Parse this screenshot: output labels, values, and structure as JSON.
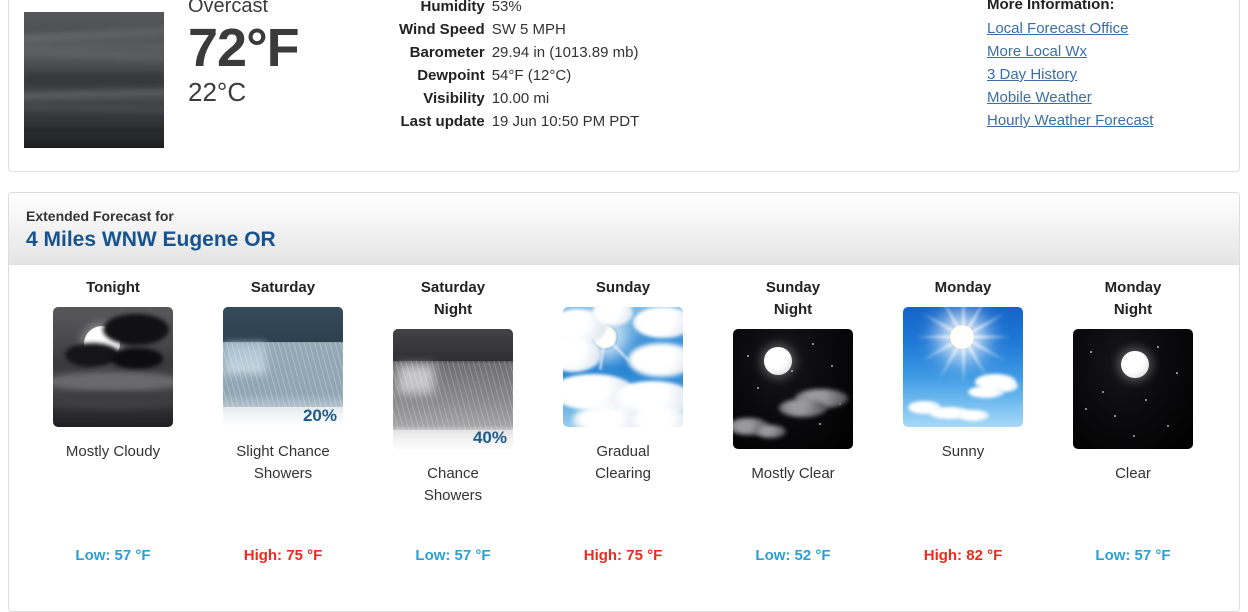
{
  "current": {
    "condition": "Overcast",
    "temp_f": "72°F",
    "temp_c": "22°C",
    "image_alt": "overcast-sky-photo",
    "details": [
      {
        "label": "Humidity",
        "value": "53%"
      },
      {
        "label": "Wind Speed",
        "value": "SW 5 MPH"
      },
      {
        "label": "Barometer",
        "value": "29.94 in (1013.89 mb)"
      },
      {
        "label": "Dewpoint",
        "value": "54°F (12°C)"
      },
      {
        "label": "Visibility",
        "value": "10.00 mi"
      },
      {
        "label": "Last update",
        "value": "19 Jun 10:50 PM PDT"
      }
    ]
  },
  "more_information": {
    "title": "More Information:",
    "links": [
      "Local Forecast Office",
      "More Local Wx",
      "3 Day History",
      "Mobile Weather",
      "Hourly Weather Forecast"
    ]
  },
  "forecast": {
    "subtitle": "Extended Forecast for",
    "location": "4 Miles WNW Eugene OR",
    "days": [
      {
        "name": "Tonight",
        "icon": "night-mostly-cloudy-icon",
        "pop": "",
        "description": "Mostly Cloudy",
        "temp_label": "Low: 57 °F",
        "temp_type": "low"
      },
      {
        "name": "Saturday",
        "icon": "rain-showers-day-icon",
        "pop": "20%",
        "description": "Slight Chance\nShowers",
        "temp_label": "High: 75 °F",
        "temp_type": "high"
      },
      {
        "name": "Saturday\nNight",
        "icon": "rain-showers-night-icon",
        "pop": "40%",
        "description": "Chance\nShowers",
        "temp_label": "Low: 57 °F",
        "temp_type": "low"
      },
      {
        "name": "Sunday",
        "icon": "partly-cloudy-day-icon",
        "pop": "",
        "description": "Gradual\nClearing",
        "temp_label": "High: 75 °F",
        "temp_type": "high"
      },
      {
        "name": "Sunday\nNight",
        "icon": "night-mostly-clear-icon",
        "pop": "",
        "description": "Mostly Clear",
        "temp_label": "Low: 52 °F",
        "temp_type": "low"
      },
      {
        "name": "Monday",
        "icon": "sunny-icon",
        "pop": "",
        "description": "Sunny",
        "temp_label": "High: 82 °F",
        "temp_type": "high"
      },
      {
        "name": "Monday\nNight",
        "icon": "night-clear-icon",
        "pop": "",
        "description": "Clear",
        "temp_label": "Low: 57 °F",
        "temp_type": "low"
      }
    ]
  },
  "colors": {
    "low_temp": "#2a9fd8",
    "high_temp": "#ee2a1e",
    "link": "#3a6ea5",
    "location_heading": "#17548f",
    "pop_text": "#1d5b8c"
  }
}
